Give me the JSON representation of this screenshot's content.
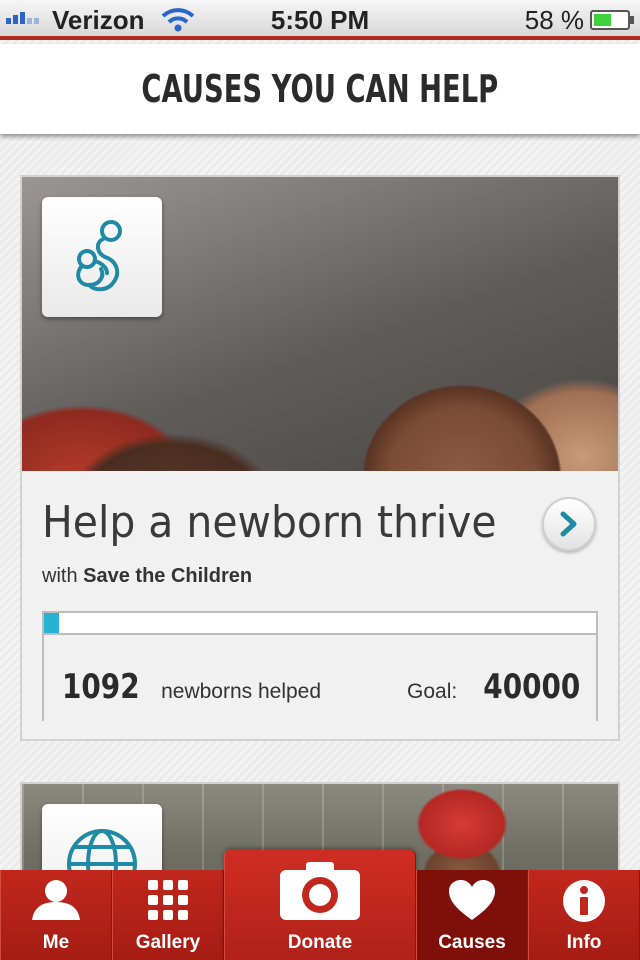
{
  "status_bar": {
    "carrier": "Verizon",
    "time": "5:50 PM",
    "battery_percent": "58 %",
    "battery_level": 0.58
  },
  "header": {
    "title": "CAUSES YOU CAN HELP"
  },
  "causes": [
    {
      "icon": "mother-child-icon",
      "title": "Help a newborn thrive",
      "with_prefix": "with",
      "partner": "Save the Children",
      "helped_count": "1092",
      "helped_label": "newborns helped",
      "goal_label": "Goal:",
      "goal_value": "40000",
      "progress_fraction": 0.0273
    },
    {
      "icon": "globe-icon"
    }
  ],
  "colors": {
    "accent_red": "#b52a20",
    "progress_blue": "#27b3d4",
    "icon_teal": "#1e8aa5"
  },
  "tabbar": {
    "items": [
      {
        "label": "Me",
        "icon": "person-icon"
      },
      {
        "label": "Gallery",
        "icon": "grid-icon"
      },
      {
        "label": "Donate",
        "icon": "camera-icon"
      },
      {
        "label": "Causes",
        "icon": "heart-icon",
        "selected": true
      },
      {
        "label": "Info",
        "icon": "info-icon"
      }
    ]
  }
}
